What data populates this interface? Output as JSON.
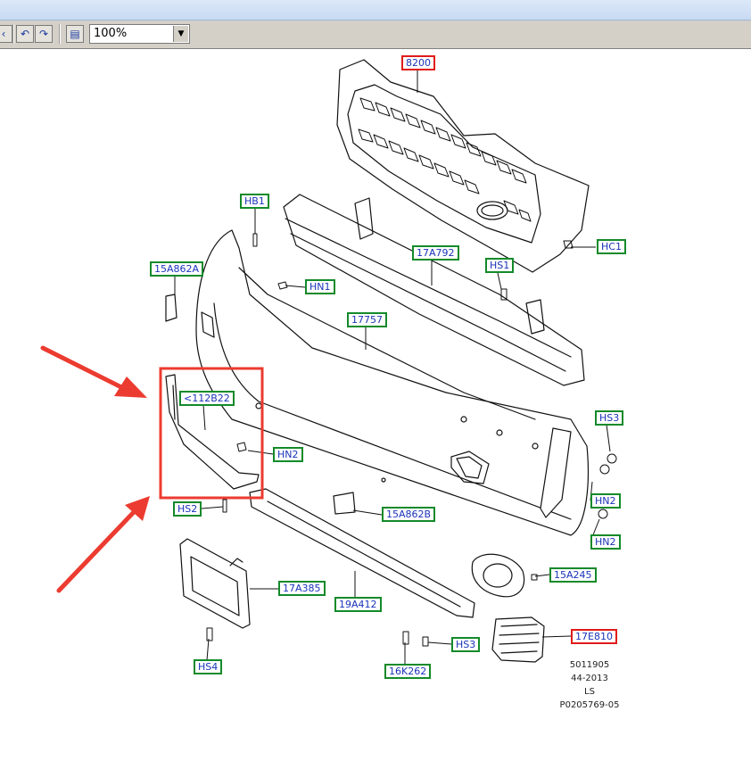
{
  "toolbar": {
    "zoom_value": "100%",
    "buttons": [
      {
        "name": "undo-view-icon"
      },
      {
        "name": "redo-view-icon"
      },
      {
        "name": "comment-icon"
      }
    ]
  },
  "colors": {
    "label_border": "#138a2a",
    "label_highlight_border": "#e01b1b",
    "label_text": "#1a34b8",
    "annotation_red": "#ec3b30"
  },
  "labels": {
    "l8200": "8200",
    "hb1": "HB1",
    "a17792": "17A792",
    "hc1": "HC1",
    "a15862a": "15A862A",
    "hs1_top": "HS1",
    "hn1": "HN1",
    "n17757": "17757",
    "b112_22": "<112B22",
    "hn2_left": "HN2",
    "hs3_right": "HS3",
    "hn2_right_a": "HN2",
    "hn2_right_b": "HN2",
    "hs2": "HS2",
    "b15862": "15A862B",
    "a17385": "17A385",
    "a19412": "19A412",
    "a15245": "15A245",
    "e17810": "17E810",
    "hs3_bottom": "HS3",
    "hs4": "HS4",
    "k16262": "16K262"
  },
  "reference": {
    "line1": "5011905",
    "line2": "44-2013",
    "line3": "LS",
    "line4": "P0205769-05"
  }
}
